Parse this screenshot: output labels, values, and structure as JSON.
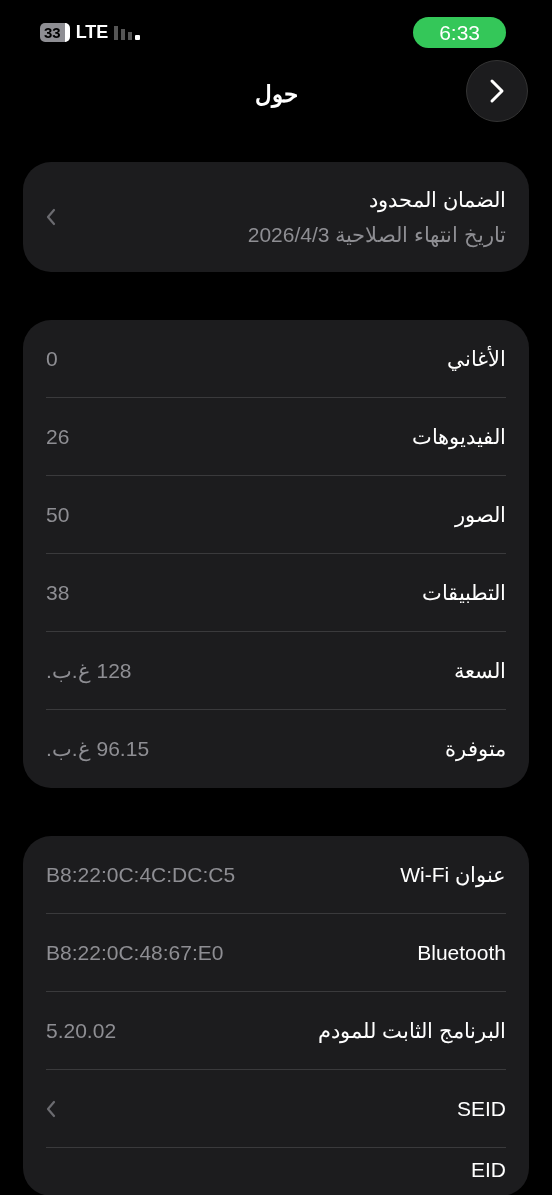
{
  "status_bar": {
    "battery": "33",
    "network": "LTE",
    "time": "6:33"
  },
  "header": {
    "title": "حول"
  },
  "warranty": {
    "title": "الضمان المحدود",
    "subtitle": "تاريخ انتهاء الصلاحية 2026/4/3"
  },
  "groups": [
    {
      "rows": [
        {
          "kind": "value",
          "label": "الأغاني",
          "value": "0"
        },
        {
          "kind": "value",
          "label": "الفيديوهات",
          "value": "26"
        },
        {
          "kind": "value",
          "label": "الصور",
          "value": "50"
        },
        {
          "kind": "value",
          "label": "التطبيقات",
          "value": "38"
        },
        {
          "kind": "value",
          "label": "السعة",
          "value": "128 غ.ب."
        },
        {
          "kind": "value",
          "label": "متوفرة",
          "value": "96.15 غ.ب."
        }
      ]
    },
    {
      "rows": [
        {
          "kind": "value",
          "label": "عنوان Wi-Fi",
          "value": "B8:22:0C:4C:DC:C5"
        },
        {
          "kind": "value",
          "label": "Bluetooth",
          "value": "B8:22:0C:48:67:E0"
        },
        {
          "kind": "value",
          "label": "البرنامج الثابت للمودم",
          "value": "5.20.02"
        },
        {
          "kind": "chevron",
          "label": "SEID"
        },
        {
          "kind": "partial",
          "label": "EID"
        }
      ]
    }
  ]
}
